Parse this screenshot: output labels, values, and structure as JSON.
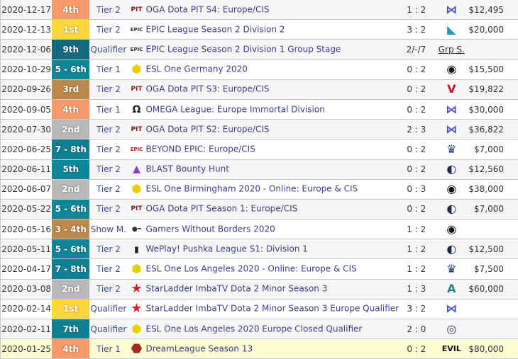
{
  "colors": {
    "4th": "#f59b6b",
    "1st": "#fdd73b",
    "9th": "#15697e",
    "5-6th": "#0d8698",
    "3rd": "#bb8a4a",
    "2nd": "#b9b9b9",
    "7-8th": "#0f7f92",
    "3-4th": "#bb8a4a",
    "7th": "#0f7f92"
  },
  "rows": [
    {
      "date": "2020-12-17",
      "place": "4th",
      "pc": "4th",
      "tier": "Tier 2",
      "icon": "oga-pit-icon",
      "tournament": "OGA Dota PIT S4: Europe/CIS",
      "score": "1 : 2",
      "opponent": "nigma-logo-icon",
      "prize": "$12,495"
    },
    {
      "date": "2020-12-13",
      "place": "1st",
      "pc": "1st",
      "tier": "Tier 2",
      "icon": "epic-league-icon",
      "tournament": "EPIC League Season 2 Division 2",
      "score": "3 : 2",
      "opponent": "bird-team-logo-icon",
      "prize": "$20,000"
    },
    {
      "date": "2020-12-06",
      "place": "9th",
      "pc": "9th",
      "tier": "Qualifier",
      "icon": "epic-league-icon",
      "tournament": "EPIC League Season 2 Division 1 Group Stage",
      "score": "2/-/7",
      "opponent_text": "Grp S.",
      "prize": ""
    },
    {
      "date": "2020-10-29",
      "place": "5 - 6th",
      "pc": "5-6th",
      "tier": "Tier 1",
      "icon": "esl-one-icon",
      "tournament": "ESL One Germany 2020",
      "score": "0 : 2",
      "opponent": "team-secret-logo-icon",
      "prize": "$15,500"
    },
    {
      "date": "2020-09-26",
      "place": "3rd",
      "pc": "3rd",
      "tier": "Tier 2",
      "icon": "oga-pit-icon",
      "tournament": "OGA Dota PIT S3: Europe/CIS",
      "score": "0 : 2",
      "opponent": "virtus-pro-logo-icon",
      "prize": "$19,822"
    },
    {
      "date": "2020-09-05",
      "place": "4th",
      "pc": "4th",
      "tier": "Tier 1",
      "icon": "omega-league-icon",
      "tournament": "OMEGA League: Europe Immortal Division",
      "score": "0 : 2",
      "opponent": "nigma-logo-icon",
      "prize": "$30,000"
    },
    {
      "date": "2020-07-30",
      "place": "2nd",
      "pc": "2nd",
      "tier": "Tier 2",
      "icon": "oga-pit-icon",
      "tournament": "OGA Dota PIT S2: Europe/CIS",
      "score": "2 : 3",
      "opponent": "nigma-logo-icon",
      "prize": "$36,822"
    },
    {
      "date": "2020-06-25",
      "place": "7 - 8th",
      "pc": "7-8th",
      "tier": "Tier 2",
      "icon": "beyond-epic-icon",
      "tournament": "BEYOND EPIC: Europe/CIS",
      "score": "0 : 2",
      "opponent": "crown-team-logo-icon",
      "prize": "$7,000"
    },
    {
      "date": "2020-06-11",
      "place": "5th",
      "pc": "5-6th",
      "tier": "Tier 2",
      "icon": "blast-icon",
      "tournament": "BLAST Bounty Hunt",
      "score": "0 : 2",
      "opponent": "team-liquid-logo-icon",
      "prize": "$12,560"
    },
    {
      "date": "2020-06-07",
      "place": "2nd",
      "pc": "2nd",
      "tier": "Tier 2",
      "icon": "esl-one-icon",
      "tournament": "ESL One Birmingham 2020 - Online: Europe & CIS",
      "score": "0 : 3",
      "opponent": "team-secret-logo-icon",
      "prize": "$38,000"
    },
    {
      "date": "2020-05-22",
      "place": "5 - 6th",
      "pc": "5-6th",
      "tier": "Tier 2",
      "icon": "oga-pit-icon",
      "tournament": "OGA Dota PIT Season 1: Europe/CIS",
      "score": "0 : 2",
      "opponent": "team-liquid-logo-icon",
      "prize": "$7,000"
    },
    {
      "date": "2020-05-16",
      "place": "3 - 4th",
      "pc": "3-4th",
      "tier": "Show M.",
      "icon": "gamers-without-borders-icon",
      "tournament": "Gamers Without Borders 2020",
      "score": "1 : 2",
      "opponent": "team-secret-logo-icon",
      "prize": ""
    },
    {
      "date": "2020-05-11",
      "place": "5 - 6th",
      "pc": "5-6th",
      "tier": "Tier 2",
      "icon": "weplay-icon",
      "tournament": "WePlay! Pushka League S1: Division 1",
      "score": "1 : 2",
      "opponent": "team-liquid-logo-icon",
      "prize": "$12,500"
    },
    {
      "date": "2020-04-17",
      "place": "7 - 8th",
      "pc": "7-8th",
      "tier": "Tier 2",
      "icon": "esl-one-icon",
      "tournament": "ESL One Los Angeles 2020 - Online: Europe & CIS",
      "score": "1 : 2",
      "opponent": "crown-team-logo-icon",
      "prize": "$7,500"
    },
    {
      "date": "2020-03-08",
      "place": "2nd",
      "pc": "2nd",
      "tier": "Tier 2",
      "icon": "starladder-icon",
      "tournament": "StarLadder ImbaTV Dota 2 Minor Season 3",
      "score": "1 : 3",
      "opponent": "alliance-logo-icon",
      "prize": "$60,000"
    },
    {
      "date": "2020-02-14",
      "place": "1st",
      "pc": "1st",
      "tier": "Qualifier",
      "icon": "starladder-icon",
      "tournament": "StarLadder ImbaTV Dota 2 Minor Season 3 Europe Qualifier",
      "score": "3 : 2",
      "opponent": "nigma-logo-icon",
      "prize": ""
    },
    {
      "date": "2020-02-11",
      "place": "7th",
      "pc": "7th",
      "tier": "Qualifier",
      "icon": "esl-one-icon",
      "tournament": "ESL One Los Angeles 2020 Europe Closed Qualifier",
      "score": "2 : 0",
      "opponent": "og-logo-icon",
      "prize": ""
    },
    {
      "date": "2020-01-25",
      "place": "4th",
      "pc": "4th",
      "tier": "Tier 1",
      "icon": "dreamleague-icon",
      "tournament": "DreamLeague Season 13",
      "score": "0 : 2",
      "opponent": "evil-geniuses-logo-icon",
      "prize": "$80,000",
      "highlight": true
    }
  ]
}
